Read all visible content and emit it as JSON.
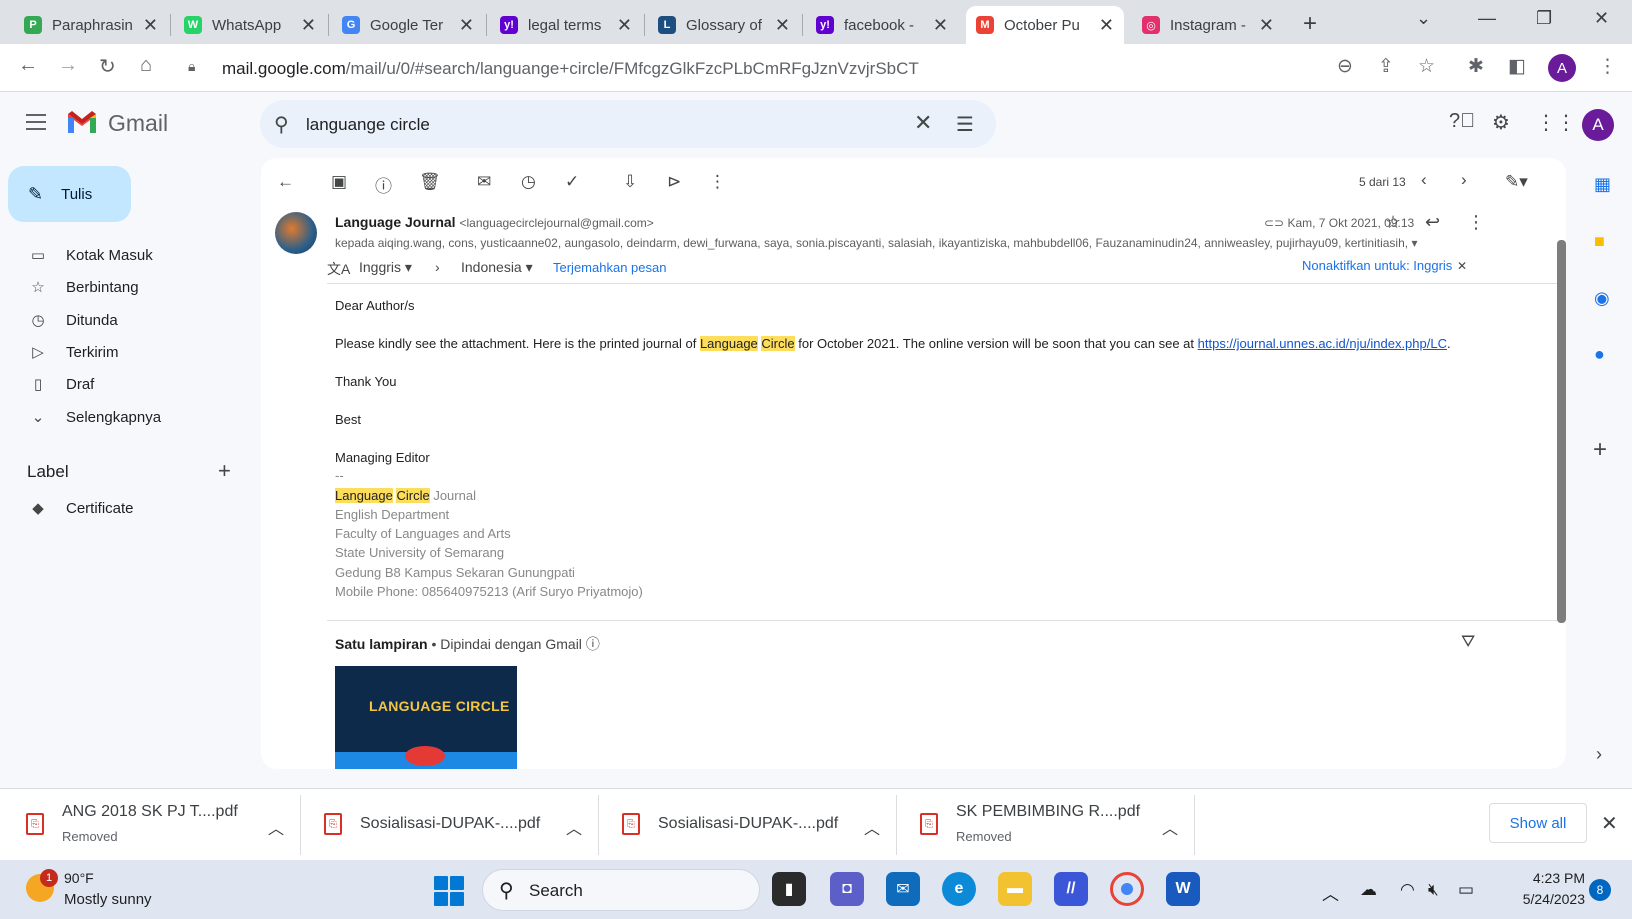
{
  "browser": {
    "tabs": [
      {
        "title": "Paraphrasin",
        "color": "#34a853",
        "glyph": "P"
      },
      {
        "title": "WhatsApp",
        "color": "#25d366",
        "glyph": "W"
      },
      {
        "title": "Google Ter",
        "color": "#4285f4",
        "glyph": "G"
      },
      {
        "title": "legal terms",
        "color": "#6001d2",
        "glyph": "y!"
      },
      {
        "title": "Glossary of",
        "color": "#1c4e80",
        "glyph": "L"
      },
      {
        "title": "facebook -",
        "color": "#6001d2",
        "glyph": "y!"
      },
      {
        "title": "October Pu",
        "color": "#ea4335",
        "glyph": "M"
      },
      {
        "title": "Instagram -",
        "color": "#e1306c",
        "glyph": "◎"
      }
    ],
    "url_host": "mail.google.com",
    "url_path": "/mail/u/0/#search/languange+circle/FMfcgzGlkFzcPLbCmRFgJznVzvjrSbCT",
    "profile_initial": "A"
  },
  "gmail": {
    "logo_text": "Gmail",
    "search_value": "languange circle",
    "compose_label": "Tulis",
    "nav": [
      {
        "label": "Kotak Masuk",
        "icon": "inbox-icon",
        "glyph": "▭"
      },
      {
        "label": "Berbintang",
        "icon": "star-icon",
        "glyph": "☆"
      },
      {
        "label": "Ditunda",
        "icon": "clock-icon",
        "glyph": "◷"
      },
      {
        "label": "Terkirim",
        "icon": "send-icon",
        "glyph": "▷"
      },
      {
        "label": "Draf",
        "icon": "draft-icon",
        "glyph": "▯"
      },
      {
        "label": "Selengkapnya",
        "icon": "chevron-down-icon",
        "glyph": "⌄"
      }
    ],
    "labels_heading": "Label",
    "labels": [
      {
        "label": "Certificate",
        "icon": "label-icon"
      }
    ],
    "pager": "5 dari 13"
  },
  "message": {
    "sender_name": "Language Journal",
    "sender_email": "<languagecirclejournal@gmail.com>",
    "date": "Kam, 7 Okt 2021, 09.13",
    "recipients": "kepada aiqing.wang, cons, yusticaanne02, aungasolo, deindarm, dewi_furwana, saya, sonia.piscayanti, salasiah, ikayantiziska, mahbubdell06, Fauzanaminudin24, anniweasley, pujirhayu09, kertinitiasih,",
    "translate": {
      "from": "Inggris",
      "to": "Indonesia",
      "action": "Terjemahkan pesan",
      "disable": "Nonaktifkan untuk: Inggris"
    },
    "body": {
      "greeting": "Dear Author/s",
      "line1_pre": "Please kindly see the attachment. Here is the printed journal of ",
      "hl1": "Language",
      "hl2": "Circle",
      "line1_post": " for October 2021. The online version will be soon that you can see at ",
      "link": "https://journal.unnes.ac.id/nju/index.php/LC",
      "line1_end": ".",
      "thanks": "Thank You",
      "best": "Best",
      "role": "Managing Editor",
      "dashes": "--",
      "sig_hl1": "Language",
      "sig_hl2": "Circle",
      "sig_rest": " Journal",
      "sig_lines": [
        "English Department",
        "Faculty of Languages and Arts",
        "State University of Semarang",
        "Gedung B8 Kampus Sekaran Gunungpati",
        "Mobile Phone: 085640975213 (Arif Suryo Priyatmojo)"
      ]
    },
    "attachment_head": "Satu lampiran",
    "attachment_scan": " • Dipindai dengan Gmail",
    "attachment_title": "LANGUAGE CIRCLE"
  },
  "downloads": [
    {
      "name": "ANG 2018 SK PJ T....pdf",
      "status": "Removed"
    },
    {
      "name": "Sosialisasi-DUPAK-....pdf",
      "status": ""
    },
    {
      "name": "Sosialisasi-DUPAK-....pdf",
      "status": ""
    },
    {
      "name": "SK PEMBIMBING R....pdf",
      "status": "Removed"
    }
  ],
  "downloads_show_all": "Show all",
  "taskbar": {
    "temp": "90°F",
    "weather": "Mostly sunny",
    "weather_badge": "1",
    "search": "Search",
    "time": "4:23 PM",
    "date": "5/24/2023",
    "notifications": "8"
  }
}
